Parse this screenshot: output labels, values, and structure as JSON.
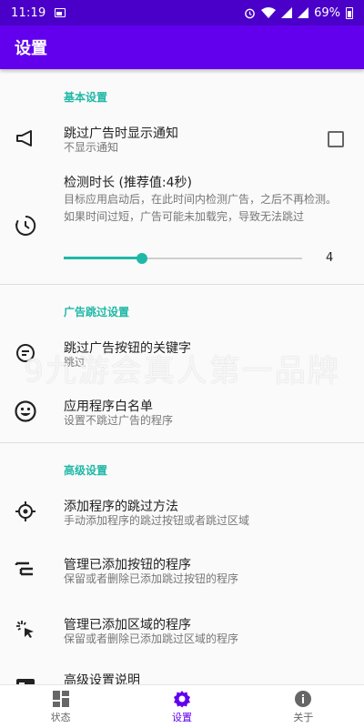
{
  "status_bar": {
    "time": "11:19",
    "battery": "69%"
  },
  "app_bar": {
    "title": "设置"
  },
  "sections": {
    "basic": "基本设置",
    "ad_skip": "广告跳过设置",
    "advanced": "高级设置"
  },
  "items": {
    "notify": {
      "title": "跳过广告时显示通知",
      "subtitle": "不显示通知",
      "checked": false,
      "icon": "megaphone-icon"
    },
    "duration": {
      "title": "检测时长 (推荐值:4秒)",
      "subtitle": "目标应用启动后，在此时间内检测广告，之后不再检测。如果时间过短，广告可能未加载完，导致无法跳过",
      "value": "4",
      "slider_fraction": 0.33,
      "icon": "timer-icon"
    },
    "keywords": {
      "title": "跳过广告按钮的关键字",
      "subtitle": "跳过",
      "icon": "keyword-icon"
    },
    "whitelist": {
      "title": "应用程序白名单",
      "subtitle": "设置不跳过广告的程序",
      "icon": "smiley-icon"
    },
    "add_method": {
      "title": "添加程序的跳过方法",
      "subtitle": "手动添加程序的跳过按钮或者跳过区域",
      "icon": "crosshair-icon"
    },
    "manage_buttons": {
      "title": "管理已添加按钮的程序",
      "subtitle": "保留或者删除已添加跳过按钮的程序",
      "icon": "list-icon"
    },
    "manage_areas": {
      "title": "管理已添加区域的程序",
      "subtitle": "保留或者删除已添加跳过区域的程序",
      "icon": "cursor-click-icon"
    },
    "advanced_help": {
      "title": "高级设置说明",
      "icon": "help-card-icon"
    }
  },
  "watermark": "9九游会真人第一品牌",
  "bottom_nav": [
    {
      "label": "状态",
      "icon": "dashboard-icon"
    },
    {
      "label": "设置",
      "icon": "gear-icon"
    },
    {
      "label": "关于",
      "icon": "info-icon"
    }
  ],
  "colors": {
    "status_bar": "#4a00c8",
    "app_bar": "#6200ee",
    "accent": "#1fb8a6",
    "nav_active": "#6200ee"
  }
}
